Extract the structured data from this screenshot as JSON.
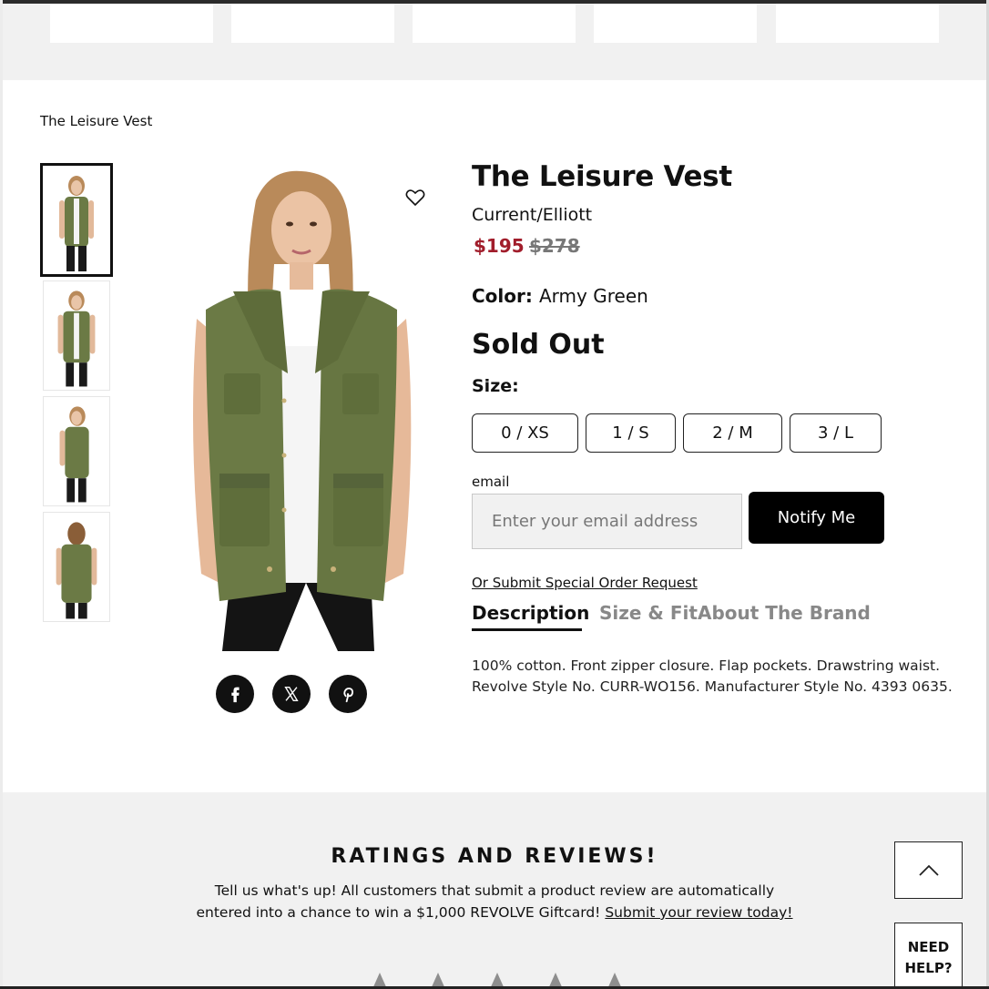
{
  "breadcrumb": "The Leisure Vest",
  "product": {
    "title": "The Leisure Vest",
    "brand": "Current/Elliott",
    "price_sale": "$195",
    "price_original": "$278",
    "color_label": "Color:",
    "color_value": "Army Green",
    "availability": "Sold Out",
    "size_label": "Size:",
    "sizes": [
      "0 / XS",
      "1 / S",
      "2 / M",
      "3 / L"
    ]
  },
  "notify": {
    "email_label": "email",
    "email_placeholder": "Enter your email address",
    "button_label": "Notify Me",
    "special_order_link": "Or Submit Special Order Request"
  },
  "tabs": [
    {
      "label": "Description",
      "active": true
    },
    {
      "label": "Size & Fit",
      "active": false
    },
    {
      "label": "About The Brand",
      "active": false
    }
  ],
  "description": "100% cotton. Front zipper closure. Flap pockets. Drawstring waist. Revolve Style No. CURR-WO156. Manufacturer Style No. 4393 0635.",
  "social": [
    {
      "name": "facebook-icon",
      "glyph": "f"
    },
    {
      "name": "x-icon",
      "glyph": "𝕏"
    },
    {
      "name": "pinterest-icon",
      "glyph": "P"
    }
  ],
  "reviews": {
    "title": "RATINGS AND REVIEWS!",
    "text": "Tell us what's up! All customers that submit a product review are automatically entered into a chance to win a $1,000 REVOLVE Giftcard!",
    "link": "Submit your review today!"
  },
  "help": {
    "need_help": "NEED HELP?"
  },
  "colors": {
    "sale_price": "#a11d2b",
    "vest": "#6b7a45",
    "button_black": "#000000"
  }
}
